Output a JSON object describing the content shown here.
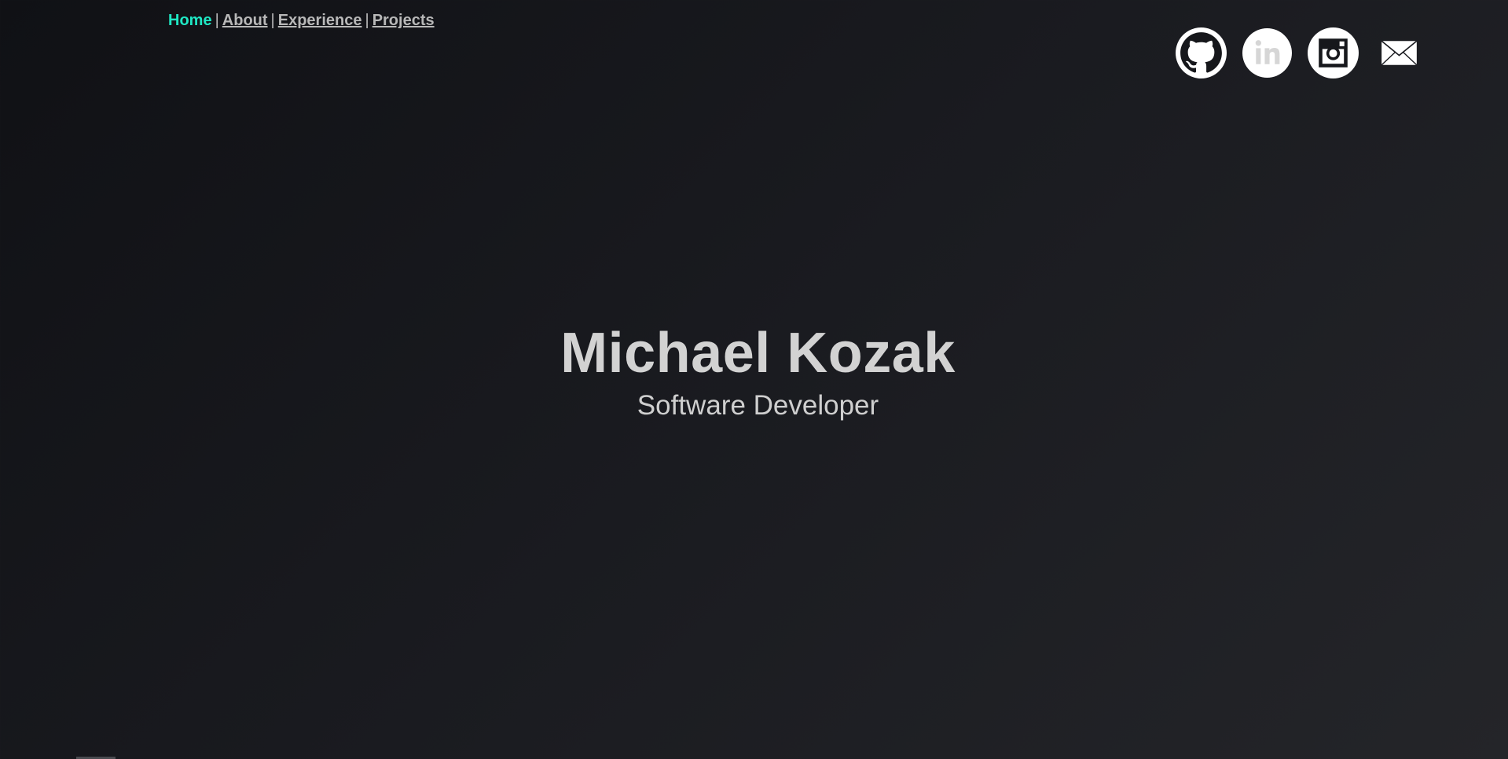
{
  "nav": {
    "items": [
      {
        "label": "Home",
        "active": true
      },
      {
        "label": "About",
        "active": false
      },
      {
        "label": "Experience",
        "active": false
      },
      {
        "label": "Projects",
        "active": false
      }
    ],
    "separator": "|"
  },
  "socials": [
    {
      "icon": "github-icon"
    },
    {
      "icon": "linkedin-icon"
    },
    {
      "icon": "instagram-icon"
    },
    {
      "icon": "mail-icon"
    }
  ],
  "hero": {
    "name": "Michael Kozak",
    "title": "Software Developer"
  },
  "colors": {
    "accent": "#1fe8c4",
    "text": "#d2d2d2",
    "background_start": "#101115",
    "background_end": "#242529"
  }
}
